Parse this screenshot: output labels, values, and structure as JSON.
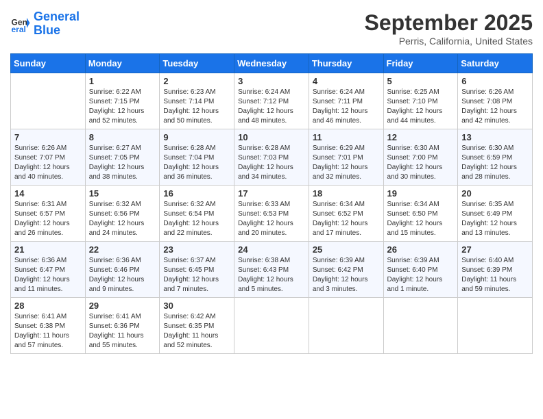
{
  "header": {
    "logo_line1": "General",
    "logo_line2": "Blue",
    "month": "September 2025",
    "location": "Perris, California, United States"
  },
  "days_of_week": [
    "Sunday",
    "Monday",
    "Tuesday",
    "Wednesday",
    "Thursday",
    "Friday",
    "Saturday"
  ],
  "weeks": [
    [
      {
        "day": "",
        "sunrise": "",
        "sunset": "",
        "daylight": ""
      },
      {
        "day": "1",
        "sunrise": "Sunrise: 6:22 AM",
        "sunset": "Sunset: 7:15 PM",
        "daylight": "Daylight: 12 hours and 52 minutes."
      },
      {
        "day": "2",
        "sunrise": "Sunrise: 6:23 AM",
        "sunset": "Sunset: 7:14 PM",
        "daylight": "Daylight: 12 hours and 50 minutes."
      },
      {
        "day": "3",
        "sunrise": "Sunrise: 6:24 AM",
        "sunset": "Sunset: 7:12 PM",
        "daylight": "Daylight: 12 hours and 48 minutes."
      },
      {
        "day": "4",
        "sunrise": "Sunrise: 6:24 AM",
        "sunset": "Sunset: 7:11 PM",
        "daylight": "Daylight: 12 hours and 46 minutes."
      },
      {
        "day": "5",
        "sunrise": "Sunrise: 6:25 AM",
        "sunset": "Sunset: 7:10 PM",
        "daylight": "Daylight: 12 hours and 44 minutes."
      },
      {
        "day": "6",
        "sunrise": "Sunrise: 6:26 AM",
        "sunset": "Sunset: 7:08 PM",
        "daylight": "Daylight: 12 hours and 42 minutes."
      }
    ],
    [
      {
        "day": "7",
        "sunrise": "Sunrise: 6:26 AM",
        "sunset": "Sunset: 7:07 PM",
        "daylight": "Daylight: 12 hours and 40 minutes."
      },
      {
        "day": "8",
        "sunrise": "Sunrise: 6:27 AM",
        "sunset": "Sunset: 7:05 PM",
        "daylight": "Daylight: 12 hours and 38 minutes."
      },
      {
        "day": "9",
        "sunrise": "Sunrise: 6:28 AM",
        "sunset": "Sunset: 7:04 PM",
        "daylight": "Daylight: 12 hours and 36 minutes."
      },
      {
        "day": "10",
        "sunrise": "Sunrise: 6:28 AM",
        "sunset": "Sunset: 7:03 PM",
        "daylight": "Daylight: 12 hours and 34 minutes."
      },
      {
        "day": "11",
        "sunrise": "Sunrise: 6:29 AM",
        "sunset": "Sunset: 7:01 PM",
        "daylight": "Daylight: 12 hours and 32 minutes."
      },
      {
        "day": "12",
        "sunrise": "Sunrise: 6:30 AM",
        "sunset": "Sunset: 7:00 PM",
        "daylight": "Daylight: 12 hours and 30 minutes."
      },
      {
        "day": "13",
        "sunrise": "Sunrise: 6:30 AM",
        "sunset": "Sunset: 6:59 PM",
        "daylight": "Daylight: 12 hours and 28 minutes."
      }
    ],
    [
      {
        "day": "14",
        "sunrise": "Sunrise: 6:31 AM",
        "sunset": "Sunset: 6:57 PM",
        "daylight": "Daylight: 12 hours and 26 minutes."
      },
      {
        "day": "15",
        "sunrise": "Sunrise: 6:32 AM",
        "sunset": "Sunset: 6:56 PM",
        "daylight": "Daylight: 12 hours and 24 minutes."
      },
      {
        "day": "16",
        "sunrise": "Sunrise: 6:32 AM",
        "sunset": "Sunset: 6:54 PM",
        "daylight": "Daylight: 12 hours and 22 minutes."
      },
      {
        "day": "17",
        "sunrise": "Sunrise: 6:33 AM",
        "sunset": "Sunset: 6:53 PM",
        "daylight": "Daylight: 12 hours and 20 minutes."
      },
      {
        "day": "18",
        "sunrise": "Sunrise: 6:34 AM",
        "sunset": "Sunset: 6:52 PM",
        "daylight": "Daylight: 12 hours and 17 minutes."
      },
      {
        "day": "19",
        "sunrise": "Sunrise: 6:34 AM",
        "sunset": "Sunset: 6:50 PM",
        "daylight": "Daylight: 12 hours and 15 minutes."
      },
      {
        "day": "20",
        "sunrise": "Sunrise: 6:35 AM",
        "sunset": "Sunset: 6:49 PM",
        "daylight": "Daylight: 12 hours and 13 minutes."
      }
    ],
    [
      {
        "day": "21",
        "sunrise": "Sunrise: 6:36 AM",
        "sunset": "Sunset: 6:47 PM",
        "daylight": "Daylight: 12 hours and 11 minutes."
      },
      {
        "day": "22",
        "sunrise": "Sunrise: 6:36 AM",
        "sunset": "Sunset: 6:46 PM",
        "daylight": "Daylight: 12 hours and 9 minutes."
      },
      {
        "day": "23",
        "sunrise": "Sunrise: 6:37 AM",
        "sunset": "Sunset: 6:45 PM",
        "daylight": "Daylight: 12 hours and 7 minutes."
      },
      {
        "day": "24",
        "sunrise": "Sunrise: 6:38 AM",
        "sunset": "Sunset: 6:43 PM",
        "daylight": "Daylight: 12 hours and 5 minutes."
      },
      {
        "day": "25",
        "sunrise": "Sunrise: 6:39 AM",
        "sunset": "Sunset: 6:42 PM",
        "daylight": "Daylight: 12 hours and 3 minutes."
      },
      {
        "day": "26",
        "sunrise": "Sunrise: 6:39 AM",
        "sunset": "Sunset: 6:40 PM",
        "daylight": "Daylight: 12 hours and 1 minute."
      },
      {
        "day": "27",
        "sunrise": "Sunrise: 6:40 AM",
        "sunset": "Sunset: 6:39 PM",
        "daylight": "Daylight: 11 hours and 59 minutes."
      }
    ],
    [
      {
        "day": "28",
        "sunrise": "Sunrise: 6:41 AM",
        "sunset": "Sunset: 6:38 PM",
        "daylight": "Daylight: 11 hours and 57 minutes."
      },
      {
        "day": "29",
        "sunrise": "Sunrise: 6:41 AM",
        "sunset": "Sunset: 6:36 PM",
        "daylight": "Daylight: 11 hours and 55 minutes."
      },
      {
        "day": "30",
        "sunrise": "Sunrise: 6:42 AM",
        "sunset": "Sunset: 6:35 PM",
        "daylight": "Daylight: 11 hours and 52 minutes."
      },
      {
        "day": "",
        "sunrise": "",
        "sunset": "",
        "daylight": ""
      },
      {
        "day": "",
        "sunrise": "",
        "sunset": "",
        "daylight": ""
      },
      {
        "day": "",
        "sunrise": "",
        "sunset": "",
        "daylight": ""
      },
      {
        "day": "",
        "sunrise": "",
        "sunset": "",
        "daylight": ""
      }
    ]
  ]
}
